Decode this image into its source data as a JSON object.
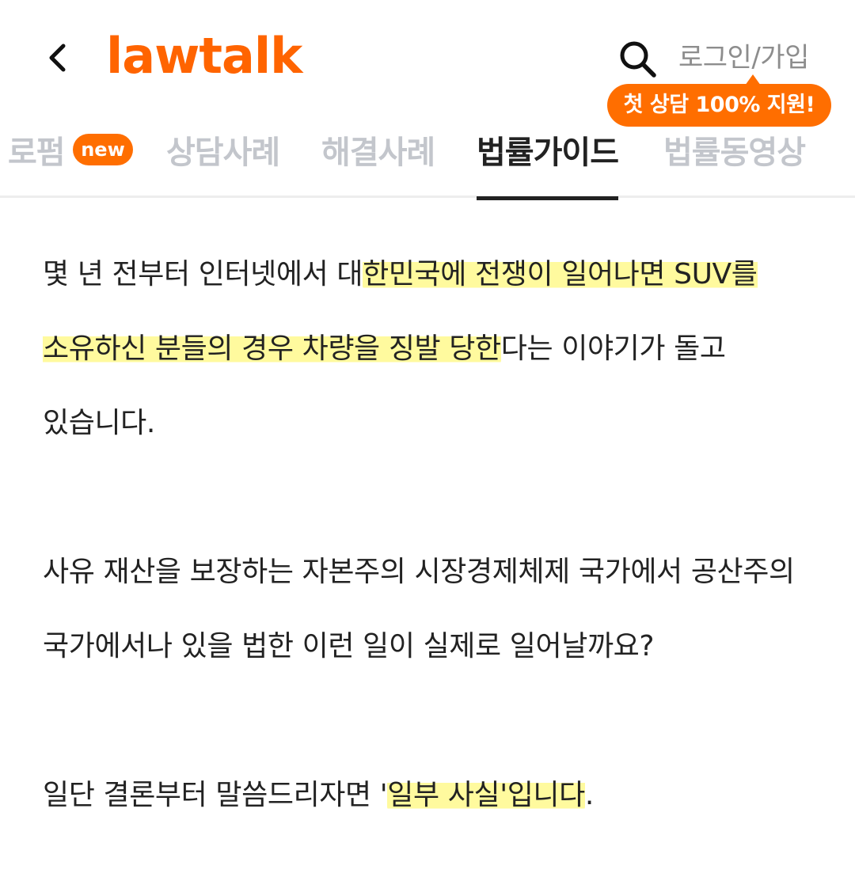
{
  "header": {
    "logo_text": "lawtalk",
    "login_label": "로그인/가입",
    "promo_badge": "첫 상담 100% 지원!",
    "back_icon": "chevron-left-icon",
    "search_icon": "search-icon",
    "brand_color": "#ff6400"
  },
  "tabs": [
    {
      "label": "로펌",
      "badge": "new",
      "active": false
    },
    {
      "label": "상담사례",
      "active": false
    },
    {
      "label": "해결사례",
      "active": false
    },
    {
      "label": "법률가이드",
      "active": true
    },
    {
      "label": "법률동영상",
      "active": false
    }
  ],
  "article": {
    "p1": {
      "before": "몇 년 전부터 인터넷에서 대",
      "highlight": "한민국에 전쟁이 일어나면 SUV를 소유하신 분들의 경우 차량을 징발 당한",
      "after": "다는 이야기가 돌고 있습니다."
    },
    "p2": "사유 재산을 보장하는 자본주의 시장경제체제 국가에서 공산주의 국가에서나 있을 법한 이런 일이 실제로 일어날까요?",
    "p3": {
      "before": "일단 결론부터 말씀드리자면 '",
      "highlight": "일부 사실'입니다",
      "after": "."
    },
    "highlight_color": "#fff878"
  }
}
